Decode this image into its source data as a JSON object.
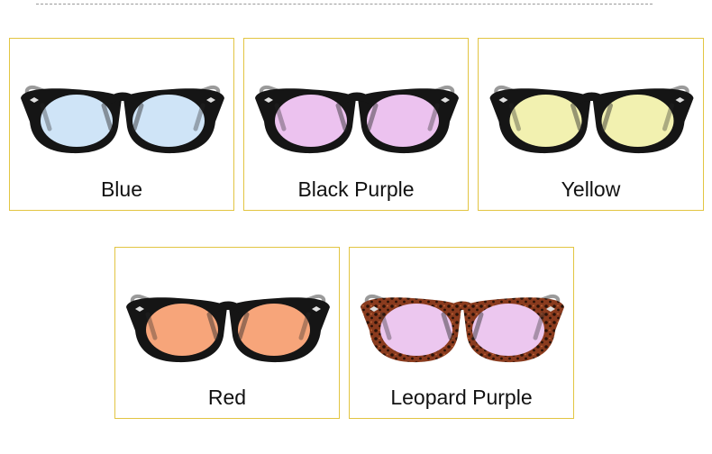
{
  "products": [
    {
      "label": "Blue",
      "lens_color": "#cfe4f7",
      "frame": "black"
    },
    {
      "label": "Black Purple",
      "lens_color": "#ecc2ef",
      "frame": "black"
    },
    {
      "label": "Yellow",
      "lens_color": "#f2f1b0",
      "frame": "black"
    },
    {
      "label": "Red",
      "lens_color": "#f7a57a",
      "frame": "black"
    },
    {
      "label": "Leopard Purple",
      "lens_color": "#ecc7ef",
      "frame": "leopard"
    }
  ],
  "colors": {
    "card_border": "#e2c542",
    "black_frame": "#151515",
    "leopard_base": "#8a3b1e",
    "leopard_spot": "#2a1208"
  }
}
